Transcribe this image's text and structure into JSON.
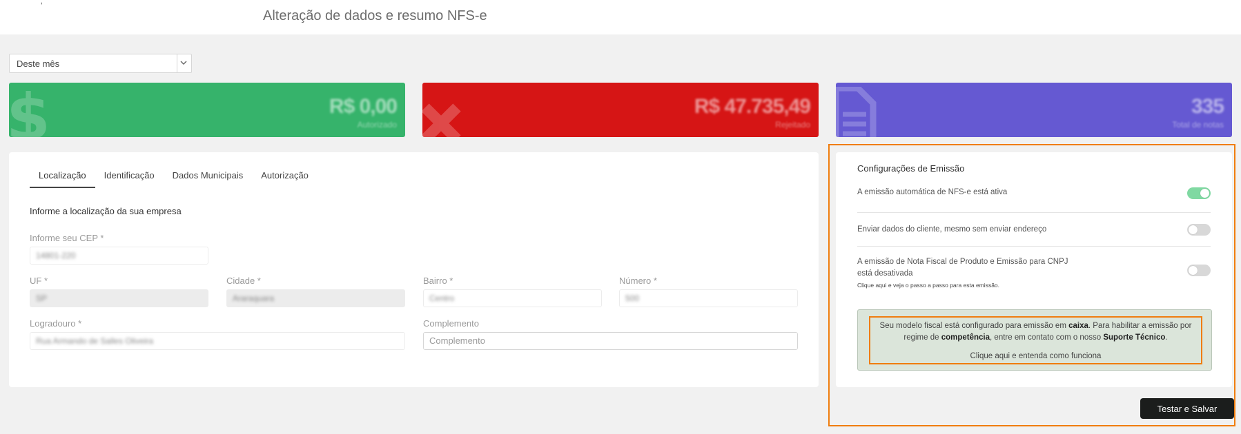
{
  "header": {
    "title": "Alteração de dados e resumo NFS-e",
    "corner_mark": "ʼ,"
  },
  "period_select": {
    "value": "Deste mês"
  },
  "stats": [
    {
      "value": "R$ 0,00",
      "label": "Autorizado",
      "color": "#36b36b",
      "icon": "dollar-icon"
    },
    {
      "value": "R$ 47.735,49",
      "label": "Rejeitado",
      "color": "#d61515",
      "icon": "x-icon"
    },
    {
      "value": "335",
      "label": "Total de notas",
      "color": "#6559d2",
      "icon": "document-icon"
    }
  ],
  "form": {
    "tabs": [
      "Localização",
      "Identificação",
      "Dados Municipais",
      "Autorização"
    ],
    "active_tab": 0,
    "intro": "Informe a localização da sua empresa",
    "fields": {
      "cep": {
        "label": "Informe seu CEP *",
        "value": "14801-220"
      },
      "uf": {
        "label": "UF *",
        "value": "SP"
      },
      "cidade": {
        "label": "Cidade *",
        "value": "Araraquara"
      },
      "bairro": {
        "label": "Bairro *",
        "value": "Centro"
      },
      "numero": {
        "label": "Número *",
        "value": "500"
      },
      "logradouro": {
        "label": "Logradouro *",
        "value": "Rua Armando de Salles Oliveira"
      },
      "complemento": {
        "label": "Complemento",
        "placeholder": "Complemento"
      }
    }
  },
  "settings": {
    "title": "Configurações de Emissão",
    "rows": [
      {
        "text": "A emissão automática de NFS-e está ativa",
        "enabled": true
      },
      {
        "text": "Enviar dados do cliente, mesmo sem enviar endereço",
        "enabled": false
      },
      {
        "text_line1": "A emissão de Nota Fiscal de Produto e Emissão para CNPJ",
        "text_line2": "está desativada",
        "sub": "Clique aqui e veja o passo a passo para esta emissão.",
        "enabled": false
      }
    ],
    "info": {
      "p1": "Seu modelo fiscal está configurado para emissão em ",
      "b1": "caixa",
      "p2": ". Para habilitar a emissão por regime de ",
      "b2": "competência",
      "p3": ", entre em contato com o nosso ",
      "b3": "Suporte Técnico",
      "p4": ".",
      "link": "Clique aqui e entenda como funciona"
    }
  },
  "actions": {
    "save_label": "Testar e Salvar"
  },
  "colors": {
    "accent_orange": "#f07d0e",
    "save_button": "#1b1d1c",
    "toggle_on": "#80d9a2"
  }
}
